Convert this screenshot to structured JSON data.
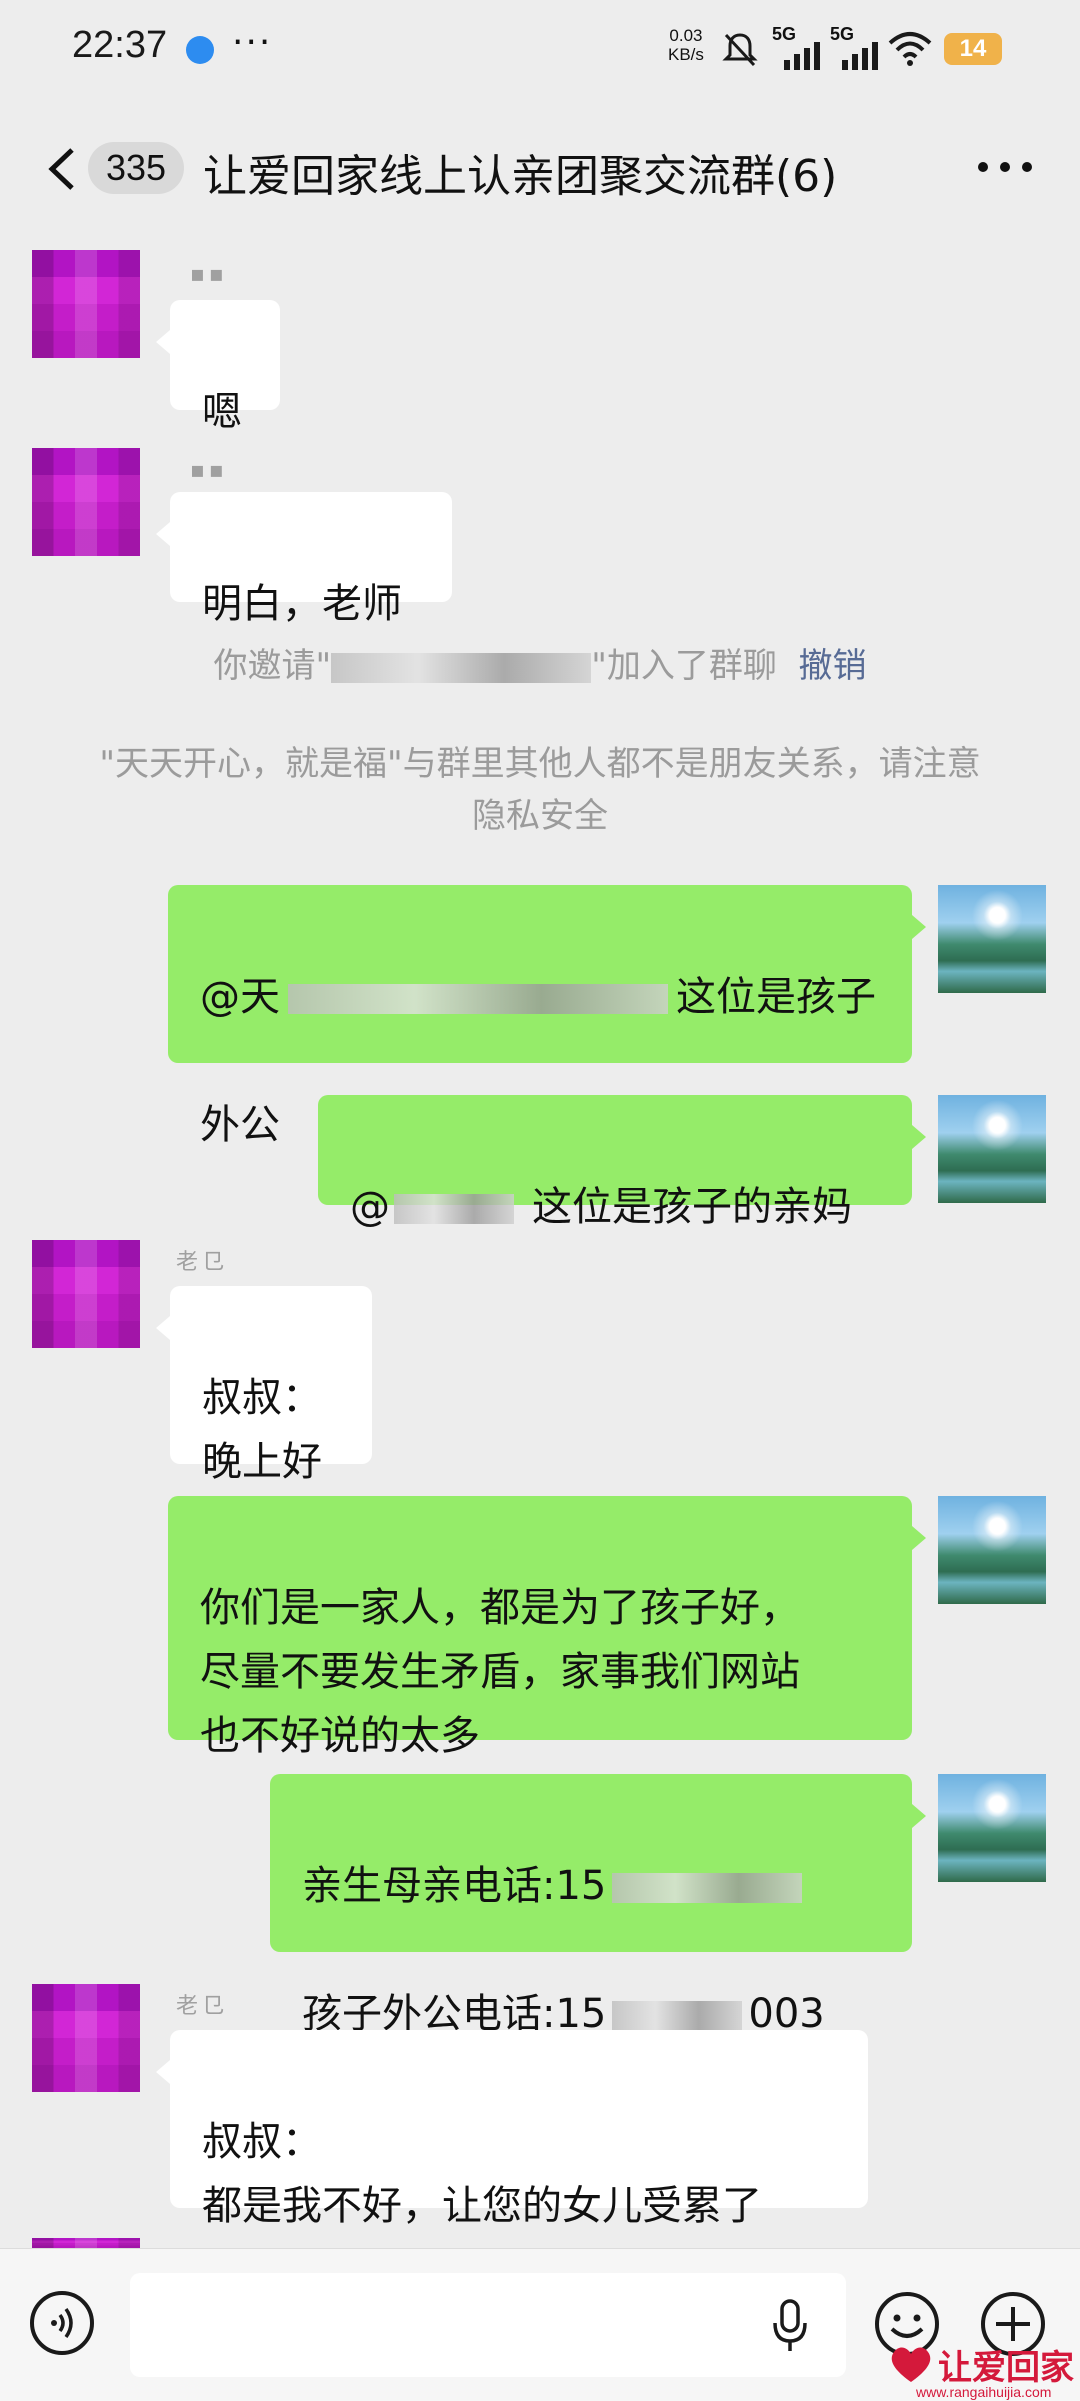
{
  "status_bar": {
    "time": "22:37",
    "more": "···",
    "net_speed_value": "0.03",
    "net_speed_unit": "KB/s",
    "signal1_label": "5G",
    "signal2_label": "5G",
    "battery": "14"
  },
  "nav": {
    "unread_count": "335",
    "title": "让爱回家线上认亲团聚交流群(6)"
  },
  "messages": [
    {
      "side": "left",
      "sender": "▪▪",
      "text": "嗯"
    },
    {
      "side": "left",
      "sender": "▪▪",
      "text": "明白，老师"
    },
    {
      "side": "system",
      "text_before": "你邀请\"",
      "text_after": "\"加入了群聊",
      "link": "撤销"
    },
    {
      "side": "system",
      "text": "\"天天开心，就是福\"与群里其他人都不是朋友关系，请注意隐私安全"
    },
    {
      "side": "right",
      "prefix": "@天",
      "text_line1_end": "这位是孩子",
      "text_line2": "外公"
    },
    {
      "side": "right",
      "prefix": "@",
      "text": "这位是孩子的亲妈"
    },
    {
      "side": "left",
      "sender": "老㔾",
      "text": "叔叔：\n晚上好"
    },
    {
      "side": "right",
      "text": "你们是一家人，都是为了孩子好，\n尽量不要发生矛盾，家事我们网站\n也不好说的太多"
    },
    {
      "side": "right",
      "line1_label": "亲生母亲电话:15",
      "line2_label": "孩子外公电话:15",
      "line2_tail": "003"
    },
    {
      "side": "left",
      "sender": "老㔾",
      "text": "叔叔：\n都是我不好，让您的女儿受累了"
    }
  ],
  "input": {
    "placeholder": ""
  },
  "watermark": {
    "text": "让爱回家",
    "url": "www.rangaihuijia.com"
  },
  "colors": {
    "background": "#ededed",
    "outgoing_bubble": "#95ec69",
    "incoming_bubble": "#ffffff",
    "link": "#576b95",
    "avatar_mosaic": "#c41dc9"
  }
}
